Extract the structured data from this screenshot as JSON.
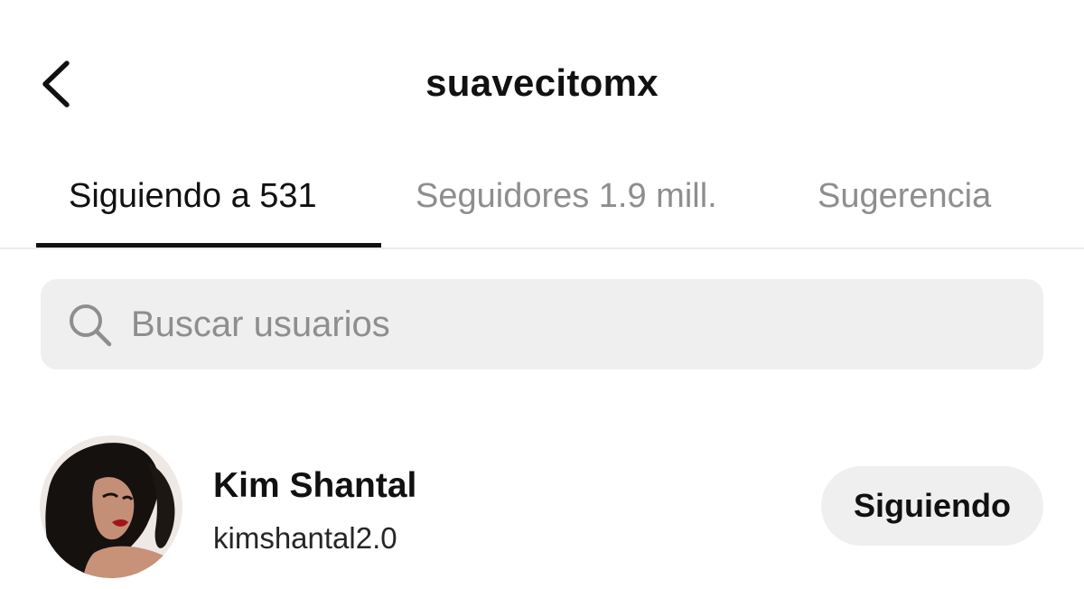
{
  "header": {
    "back_icon": "chevron-left-icon",
    "title": "suavecitomx"
  },
  "tabs": [
    {
      "label": "Siguiendo a 531",
      "active": true
    },
    {
      "label": "Seguidores 1.9 mill.",
      "active": false
    },
    {
      "label": "Sugerencia",
      "active": false
    }
  ],
  "search": {
    "icon": "search-icon",
    "placeholder": "Buscar usuarios",
    "value": ""
  },
  "users": [
    {
      "display_name": "Kim Shantal",
      "handle": "kimshantal2.0",
      "button_label": "Siguiendo"
    }
  ],
  "colors": {
    "text_primary": "#111111",
    "text_secondary": "#8e8e8e",
    "surface": "#efefef",
    "divider": "#ececec"
  }
}
